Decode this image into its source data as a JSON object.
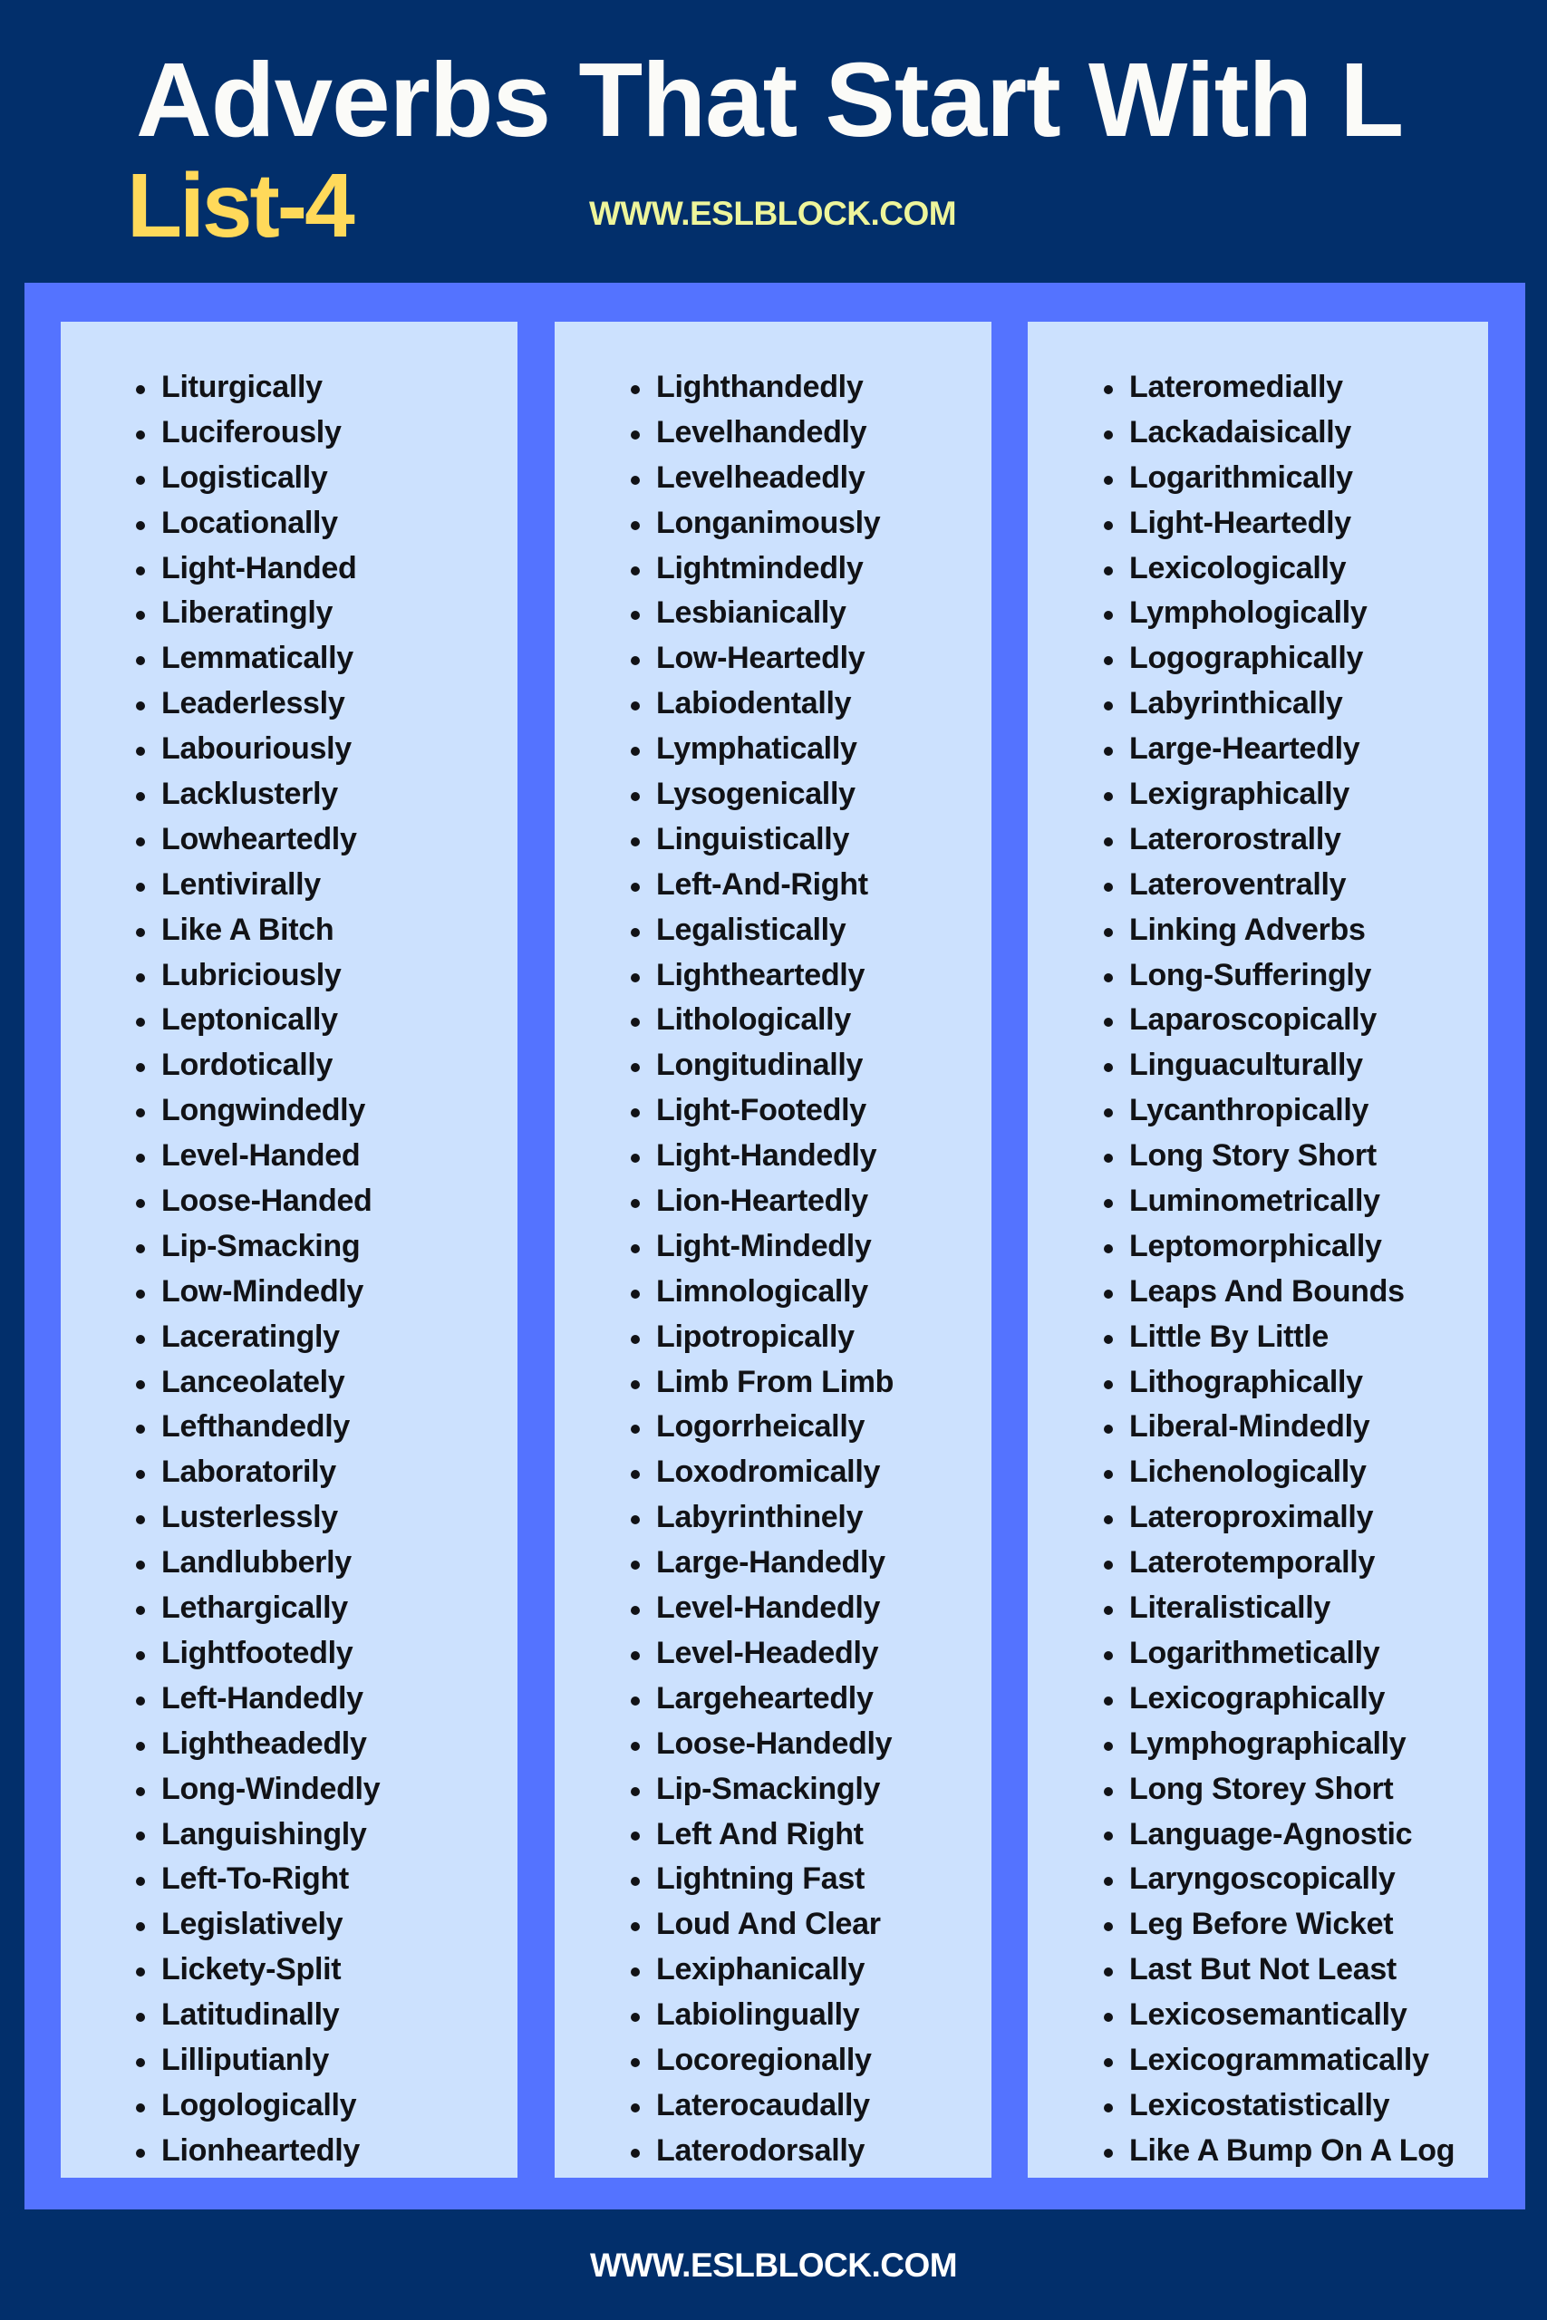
{
  "header": {
    "title": "Adverbs That Start With L",
    "list_label": "List-4",
    "site_url": "WWW.ESLBLOCK.COM"
  },
  "colors": {
    "background": "#022f6b",
    "frame": "#5473ff",
    "column_bg": "#cce1fe",
    "title": "#fbfbf8",
    "list_label": "#ffd95a",
    "site_url_top": "#eef59b",
    "site_url_bottom": "#ffffff",
    "item_text": "#111216"
  },
  "columns": [
    {
      "items": [
        "Liturgically",
        "Luciferously",
        "Logistically",
        "Locationally",
        "Light-Handed",
        "Liberatingly",
        "Lemmatically",
        "Leaderlessly",
        "Labouriously",
        "Lacklusterly",
        "Lowheartedly",
        "Lentivirally",
        "Like A Bitch",
        "Lubriciously",
        "Leptonically",
        "Lordotically",
        "Longwindedly",
        "Level-Handed",
        "Loose-Handed",
        "Lip-Smacking",
        "Low-Mindedly",
        "Laceratingly",
        "Lanceolately",
        "Lefthandedly",
        "Laboratorily",
        "Lusterlessly",
        "Landlubberly",
        "Lethargically",
        "Lightfootedly",
        "Left-Handedly",
        "Lightheadedly",
        "Long-Windedly",
        "Languishingly",
        "Left-To-Right",
        "Legislatively",
        "Lickety-Split",
        "Latitudinally",
        "Lilliputianly",
        "Logologically",
        "Lionheartedly"
      ]
    },
    {
      "items": [
        "Lighthandedly",
        "Levelhandedly",
        "Levelheadedly",
        "Longanimously",
        "Lightmindedly",
        "Lesbianically",
        "Low-Heartedly",
        "Labiodentally",
        "Lymphatically",
        "Lysogenically",
        "Linguistically",
        "Left-And-Right",
        "Legalistically",
        "Lightheartedly",
        "Lithologically",
        "Longitudinally",
        "Light-Footedly",
        "Light-Handedly",
        "Lion-Heartedly",
        "Light-Mindedly",
        "Limnologically",
        "Lipotropically",
        "Limb From Limb",
        "Logorrheically",
        "Loxodromically",
        "Labyrinthinely",
        "Large-Handedly",
        "Level-Handedly",
        "Level-Headedly",
        "Largeheartedly",
        "Loose-Handedly",
        "Lip-Smackingly",
        "Left And Right",
        "Lightning Fast",
        "Loud And Clear",
        "Lexiphanically",
        "Labiolingually",
        "Locoregionally",
        "Laterocaudally",
        "Laterodorsally"
      ]
    },
    {
      "items": [
        "Lateromedially",
        "Lackadaisically",
        "Logarithmically",
        "Light-Heartedly",
        "Lexicologically",
        "Lymphologically",
        "Logographically",
        "Labyrinthically",
        "Large-Heartedly",
        "Lexigraphically",
        "Laterorostrally",
        "Lateroventrally",
        "Linking Adverbs",
        "Long-Sufferingly",
        "Laparoscopically",
        "Linguaculturally",
        "Lycanthropically",
        "Long Story Short",
        "Luminometrically",
        "Leptomorphically",
        "Leaps And Bounds",
        "Little By Little",
        "Lithographically",
        "Liberal-Mindedly",
        "Lichenologically",
        "Lateroproximally",
        "Laterotemporally",
        "Literalistically",
        "Logarithmetically",
        "Lexicographically",
        "Lymphographically",
        "Long Storey Short",
        "Language-Agnostic",
        "Laryngoscopically",
        "Leg Before Wicket",
        "Last But Not Least",
        "Lexicosemantically",
        "Lexicogrammatically",
        "Lexicostatistically",
        "Like A Bump On A Log"
      ]
    }
  ],
  "footer": {
    "site_url": "WWW.ESLBLOCK.COM"
  }
}
